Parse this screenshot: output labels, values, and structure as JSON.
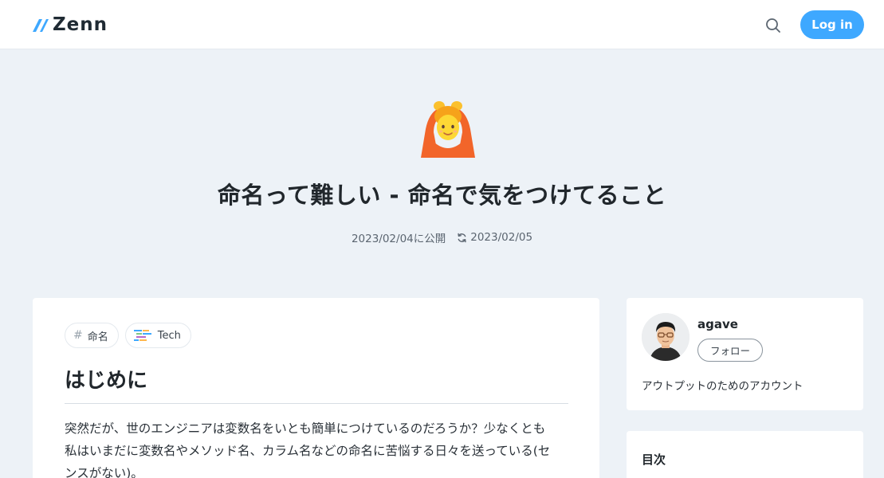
{
  "header": {
    "logo_text": "Zenn",
    "login_label": "Log in",
    "icons": {
      "search": "search-icon",
      "logo": "zenn-logo-icon"
    },
    "accent_color": "#3ea8ff"
  },
  "article": {
    "emoji": "person-gesturing-ok-icon",
    "title": "命名って難しい - 命名で気をつけてること",
    "published": "2023/02/04に公開",
    "updated": "2023/02/05",
    "topics": [
      {
        "label": "命名",
        "icon": "hash-icon"
      },
      {
        "label": "Tech",
        "icon": "tech-icon"
      }
    ],
    "section_heading": "はじめに",
    "body_lines": [
      "突然だが、世のエンジニアは変数名をいとも簡単につけているのだろうか？少なくとも",
      "私はいまだに変数名やメソッド名、カラム名などの命名に苦悩する日々を送っている(セ",
      "ンスがない)。"
    ]
  },
  "author": {
    "name": "agave",
    "follow_label": "フォロー",
    "bio": "アウトプットのためのアカウント"
  },
  "toc": {
    "title": "目次"
  }
}
